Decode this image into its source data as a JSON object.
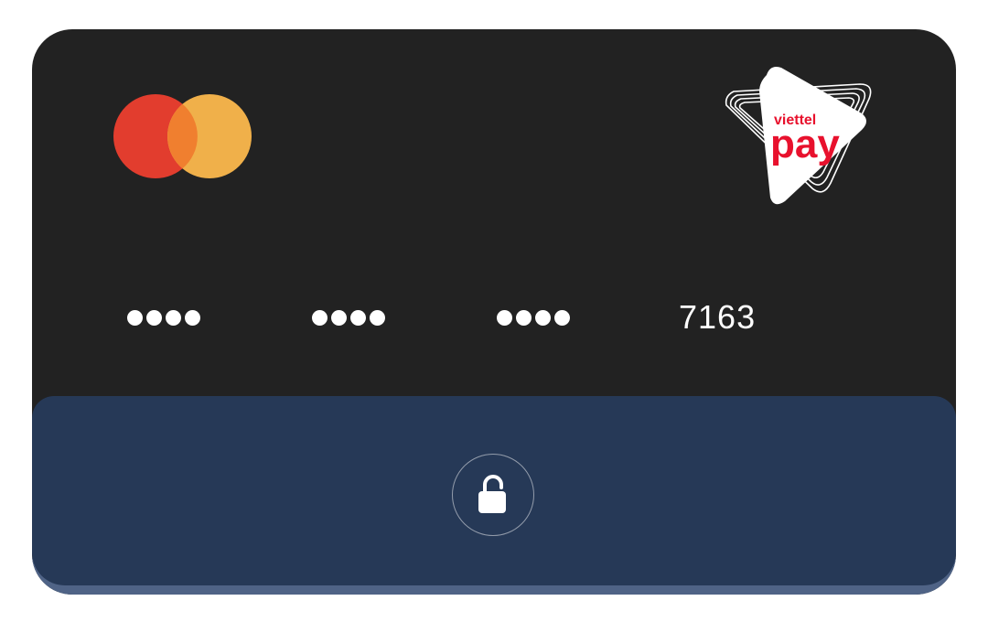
{
  "card": {
    "network_icon": "mastercard-logo",
    "brand": {
      "top_text": "viettel",
      "main_text": "pay",
      "accent_color": "#e8112d"
    },
    "number": {
      "mask_groups": [
        "••••",
        "••••",
        "••••"
      ],
      "last_four": "7163"
    },
    "lock": {
      "icon": "unlock-icon",
      "state": "unlocked"
    },
    "colors": {
      "card_background": "#222222",
      "panel_background": "#263957",
      "mc_red": "#e23d2e",
      "mc_orange": "#f0b04a"
    }
  }
}
